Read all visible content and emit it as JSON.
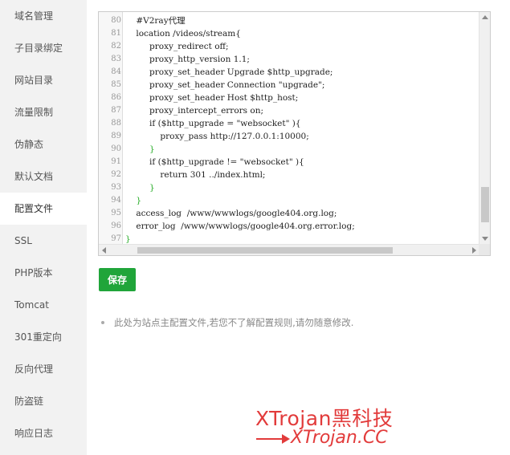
{
  "sidebar": {
    "items": [
      {
        "label": "域名管理"
      },
      {
        "label": "子目录绑定"
      },
      {
        "label": "网站目录"
      },
      {
        "label": "流量限制"
      },
      {
        "label": "伪静态"
      },
      {
        "label": "默认文档"
      },
      {
        "label": "配置文件",
        "active": true
      },
      {
        "label": "SSL"
      },
      {
        "label": "PHP版本"
      },
      {
        "label": "Tomcat"
      },
      {
        "label": "301重定向"
      },
      {
        "label": "反向代理"
      },
      {
        "label": "防盗链"
      },
      {
        "label": "响应日志"
      }
    ]
  },
  "editor": {
    "lines": [
      {
        "n": "80",
        "t": "    #V2ray代理"
      },
      {
        "n": "81",
        "t": "    location /videos/stream{"
      },
      {
        "n": "82",
        "t": "         proxy_redirect off;"
      },
      {
        "n": "83",
        "t": "         proxy_http_version 1.1;"
      },
      {
        "n": "84",
        "t": "         proxy_set_header Upgrade $http_upgrade;"
      },
      {
        "n": "85",
        "t": "         proxy_set_header Connection \"upgrade\";"
      },
      {
        "n": "86",
        "t": "         proxy_set_header Host $http_host;"
      },
      {
        "n": "87",
        "t": "         proxy_intercept_errors on;"
      },
      {
        "n": "88",
        "t": "         if ($http_upgrade = \"websocket\" ){"
      },
      {
        "n": "89",
        "t": "             proxy_pass http://127.0.0.1:10000;"
      },
      {
        "n": "90",
        "t": "         }"
      },
      {
        "n": "91",
        "t": "         if ($http_upgrade != \"websocket\" ){"
      },
      {
        "n": "92",
        "t": "             return 301 ../index.html;"
      },
      {
        "n": "93",
        "t": "         }"
      },
      {
        "n": "94",
        "t": "    }"
      },
      {
        "n": "95",
        "t": "    access_log  /www/wwwlogs/google404.org.log;"
      },
      {
        "n": "96",
        "t": "    error_log  /www/wwwlogs/google404.org.error.log;"
      },
      {
        "n": "97",
        "t": "}"
      }
    ]
  },
  "actions": {
    "save_label": "保存"
  },
  "tip": {
    "text": "此处为站点主配置文件,若您不了解配置规则,请勿随意修改."
  },
  "watermark": {
    "line1": "XTrojan黑科技",
    "line2": "XTrojan.CC"
  },
  "colors": {
    "accent": "#20a53a",
    "watermark": "#e23b3b"
  }
}
